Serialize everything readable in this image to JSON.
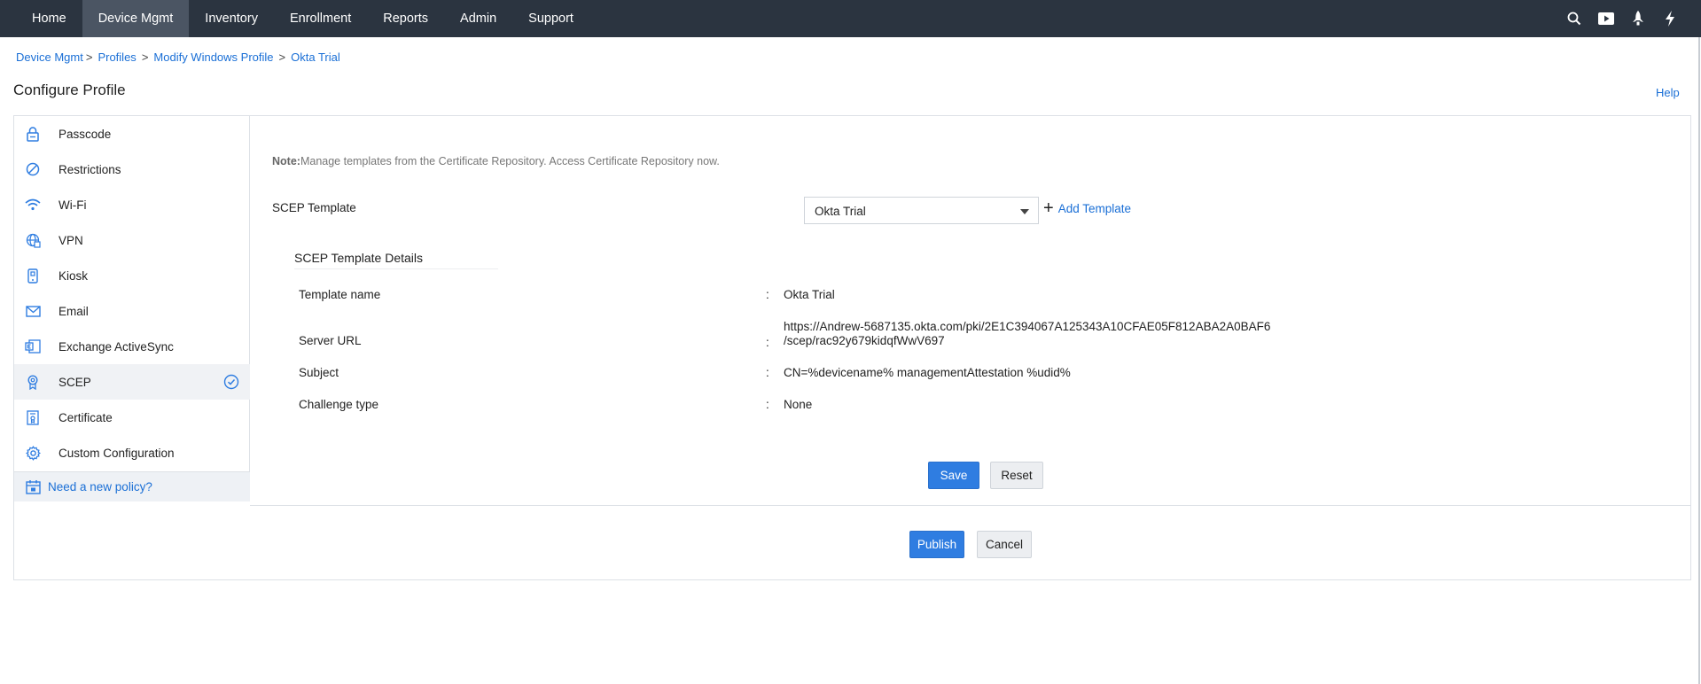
{
  "nav": {
    "items": [
      {
        "label": "Home",
        "active": false
      },
      {
        "label": "Device Mgmt",
        "active": true
      },
      {
        "label": "Inventory",
        "active": false
      },
      {
        "label": "Enrollment",
        "active": false
      },
      {
        "label": "Reports",
        "active": false
      },
      {
        "label": "Admin",
        "active": false
      },
      {
        "label": "Support",
        "active": false
      }
    ],
    "tools": [
      "search-icon",
      "video-icon",
      "rocket-icon",
      "flash-icon"
    ]
  },
  "breadcrumb": {
    "items": [
      "Device Mgmt",
      "Profiles",
      "Modify Windows Profile",
      "Okta Trial"
    ],
    "separator": ">"
  },
  "page": {
    "title": "Configure Profile",
    "help": "Help"
  },
  "sidebar": {
    "items": [
      {
        "label": "Passcode",
        "icon": "lock-icon"
      },
      {
        "label": "Restrictions",
        "icon": "block-icon"
      },
      {
        "label": "Wi-Fi",
        "icon": "wifi-icon"
      },
      {
        "label": "VPN",
        "icon": "globe-icon"
      },
      {
        "label": "Kiosk",
        "icon": "kiosk-icon"
      },
      {
        "label": "Email",
        "icon": "mail-icon"
      },
      {
        "label": "Exchange ActiveSync",
        "icon": "exchange-icon"
      },
      {
        "label": "SCEP",
        "icon": "badge-icon",
        "active": true,
        "configured": true
      },
      {
        "label": "Certificate",
        "icon": "certificate-icon"
      },
      {
        "label": "Custom Configuration",
        "icon": "gear-icon"
      }
    ],
    "new_policy": "Need a new policy?"
  },
  "content": {
    "note_prefix": "Note:",
    "note_text": "Manage templates from the Certificate Repository. Access Certificate Repository now.",
    "scep_template_label": "SCEP Template",
    "scep_template_value": "Okta Trial",
    "add_template": "Add Template",
    "details_title": "SCEP Template Details",
    "details": {
      "template_name_label": "Template name",
      "template_name_value": "Okta Trial",
      "server_url_label": "Server URL",
      "server_url_line1": "https://Andrew-5687135.okta.com/pki/2E1C394067A125343A10CFAE05F812ABA2A0BAF6",
      "server_url_line2": "/scep/rac92y679kidqfWwV697",
      "subject_label": "Subject",
      "subject_value": "CN=%devicename% managementAttestation %udid%",
      "challenge_label": "Challenge type",
      "challenge_value": "None",
      "colon": ":"
    },
    "save": "Save",
    "reset": "Reset"
  },
  "footer": {
    "publish": "Publish",
    "cancel": "Cancel"
  },
  "colors": {
    "topbar": "#2b3440",
    "active_nav": "#4b5563",
    "link": "#1a6fd6",
    "primary": "#2f7de1"
  }
}
